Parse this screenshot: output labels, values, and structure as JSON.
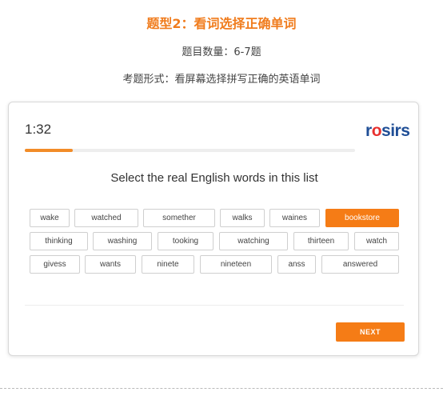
{
  "header": {
    "title": "题型2：看词选择正确单词",
    "count": "题目数量：6-7题",
    "format": "考题形式：看屏幕选择拼写正确的英语单词"
  },
  "quiz": {
    "timer": "1:32",
    "logo": {
      "part1": "r",
      "part2": "o",
      "part3": "sirs"
    },
    "progress_fraction": 0.145,
    "prompt": "Select the real English words in this list",
    "words": [
      [
        "wake",
        "watched",
        "somether",
        "walks",
        "waines",
        "bookstore"
      ],
      [
        "thinking",
        "washing",
        "tooking",
        "watching",
        "thirteen",
        "watch"
      ],
      [
        "givess",
        "wants",
        "ninete",
        "nineteen",
        "anss",
        "answered"
      ]
    ],
    "selected_word": "bookstore",
    "next_label": "NEXT"
  },
  "colors": {
    "accent": "#f57c16",
    "title": "#f07c1d",
    "logo_blue": "#1f4e96",
    "logo_red": "#e8312f"
  }
}
